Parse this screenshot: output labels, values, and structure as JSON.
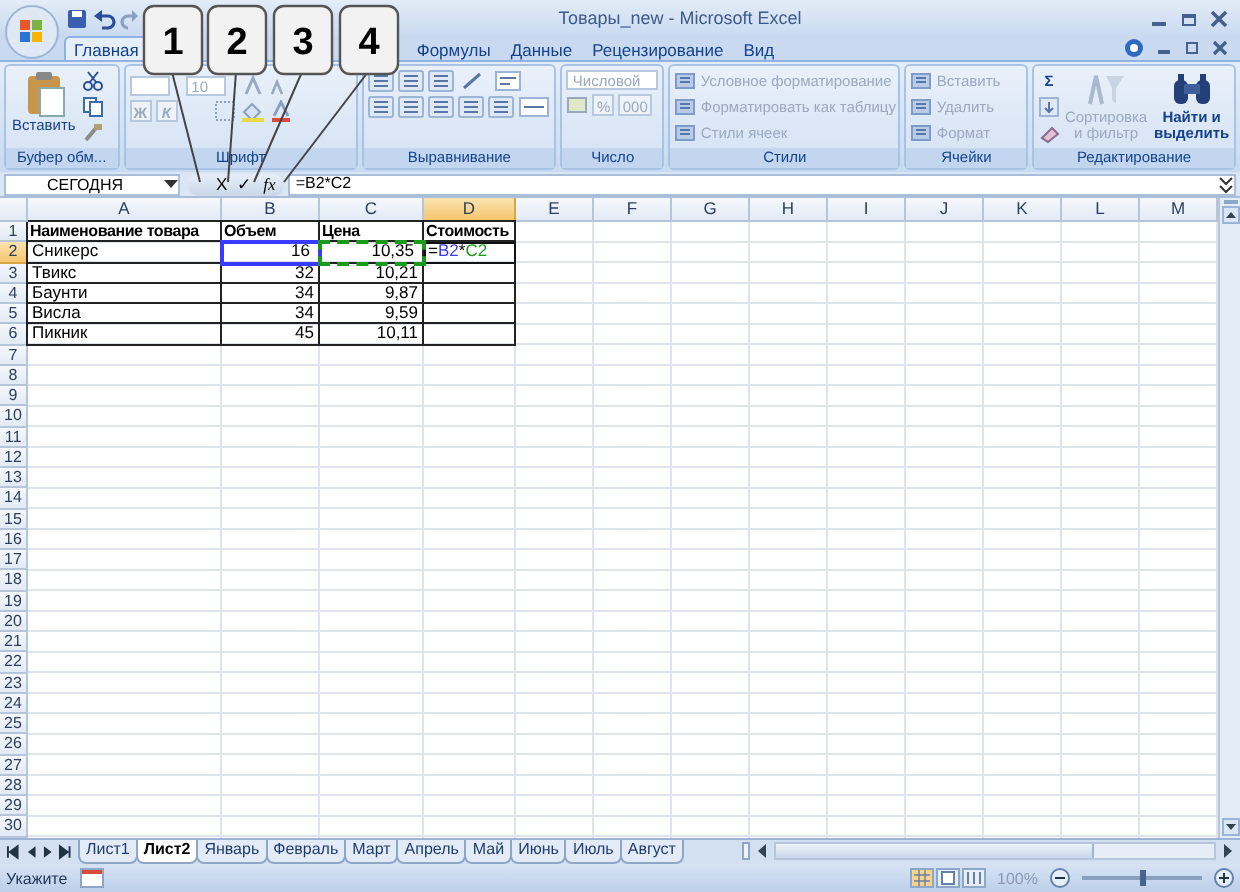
{
  "window": {
    "title": "Товары_new - Microsoft Excel"
  },
  "ribbon_tabs": [
    {
      "label": "Главная",
      "selected": true
    },
    {
      "label": "Формулы",
      "selected": false
    },
    {
      "label": "Данные",
      "selected": false
    },
    {
      "label": "Рецензирование",
      "selected": false
    },
    {
      "label": "Вид",
      "selected": false
    }
  ],
  "ribbon_groups": [
    {
      "kind": "clipboard",
      "label": "Буфер обм...",
      "items": [
        {
          "label": "Вставить",
          "disabled": false
        }
      ]
    },
    {
      "kind": "font",
      "label": "Шрифт",
      "items": [
        {
          "label": "10",
          "disabled": true
        },
        {
          "label": "Ж",
          "disabled": true
        },
        {
          "label": "К",
          "disabled": true
        }
      ]
    },
    {
      "kind": "alignment",
      "label": "Выравнивание"
    },
    {
      "kind": "number",
      "label": "Число",
      "items": [
        {
          "label": "Числовой",
          "disabled": true
        },
        {
          "label": "%",
          "disabled": true
        },
        {
          "label": "000",
          "disabled": true
        }
      ]
    },
    {
      "kind": "styles",
      "label": "Стили",
      "items": [
        {
          "label": "Условное форматирование",
          "disabled": true
        },
        {
          "label": "Форматировать как таблицу",
          "disabled": true
        },
        {
          "label": "Стили ячеек",
          "disabled": true
        }
      ]
    },
    {
      "kind": "cells",
      "label": "Ячейки",
      "items": [
        {
          "label": "Вставить",
          "disabled": true
        },
        {
          "label": "Удалить",
          "disabled": true
        },
        {
          "label": "Формат",
          "disabled": true
        }
      ]
    },
    {
      "kind": "editing",
      "label": "Редактирование",
      "items": [
        {
          "label": "Σ",
          "disabled": false
        },
        {
          "label": "Сортировка и фильтр",
          "disabled": true
        },
        {
          "label": "Найти и выделить",
          "disabled": false
        }
      ]
    }
  ],
  "formula_bar": {
    "name_box": "СЕГОДНЯ",
    "cancel": "X",
    "enter": "✓",
    "function": "fx",
    "formula": "=B2*C2"
  },
  "callouts": [
    {
      "label": "1"
    },
    {
      "label": "2"
    },
    {
      "label": "3"
    },
    {
      "label": "4"
    }
  ],
  "columns": [
    {
      "label": "A",
      "selected": false
    },
    {
      "label": "B",
      "selected": false
    },
    {
      "label": "C",
      "selected": false
    },
    {
      "label": "D",
      "selected": true
    },
    {
      "label": "E",
      "selected": false
    },
    {
      "label": "F",
      "selected": false
    },
    {
      "label": "G",
      "selected": false
    },
    {
      "label": "H",
      "selected": false
    },
    {
      "label": "I",
      "selected": false
    },
    {
      "label": "J",
      "selected": false
    },
    {
      "label": "K",
      "selected": false
    },
    {
      "label": "L",
      "selected": false
    },
    {
      "label": "M",
      "selected": false
    }
  ],
  "rows": [
    {
      "header": "1",
      "selected": false,
      "cells": [
        {
          "kind": "header",
          "text": "Наименование товара"
        },
        {
          "kind": "header",
          "text": "Объем"
        },
        {
          "kind": "header",
          "text": "Цена"
        },
        {
          "kind": "header",
          "text": "Стоимость"
        }
      ]
    },
    {
      "header": "2",
      "selected": true,
      "cells": [
        {
          "kind": "text",
          "text": "Сникерс"
        },
        {
          "kind": "number",
          "text": "16",
          "color": "#3a3aff",
          "marquee": false
        },
        {
          "kind": "number",
          "text": "10,35",
          "color": "#1a9a1a",
          "marquee": true
        },
        {
          "kind": "formula",
          "active": true,
          "parts": [
            {
              "text": "="
            },
            {
              "text": "B2",
              "color": "#3a3aff"
            },
            {
              "text": "*"
            },
            {
              "text": "C2",
              "color": "#1a9a1a"
            }
          ]
        }
      ]
    },
    {
      "header": "3",
      "selected": false,
      "cells": [
        {
          "kind": "text",
          "text": "Твикс"
        },
        {
          "kind": "number",
          "text": "32"
        },
        {
          "kind": "number",
          "text": "10,21"
        },
        {
          "kind": "empty"
        }
      ]
    },
    {
      "header": "4",
      "selected": false,
      "cells": [
        {
          "kind": "text",
          "text": "Баунти"
        },
        {
          "kind": "number",
          "text": "34"
        },
        {
          "kind": "number",
          "text": "9,87"
        },
        {
          "kind": "empty"
        }
      ]
    },
    {
      "header": "5",
      "selected": false,
      "cells": [
        {
          "kind": "text",
          "text": "Висла"
        },
        {
          "kind": "number",
          "text": "34"
        },
        {
          "kind": "number",
          "text": "9,59"
        },
        {
          "kind": "empty"
        }
      ]
    },
    {
      "header": "6",
      "selected": false,
      "cells": [
        {
          "kind": "text",
          "text": "Пикник"
        },
        {
          "kind": "number",
          "text": "45"
        },
        {
          "kind": "number",
          "text": "10,11"
        },
        {
          "kind": "empty"
        }
      ]
    },
    {
      "header": "7",
      "selected": false
    },
    {
      "header": "8",
      "selected": false
    },
    {
      "header": "9",
      "selected": false
    },
    {
      "header": "10",
      "selected": false
    },
    {
      "header": "11",
      "selected": false
    },
    {
      "header": "12",
      "selected": false
    },
    {
      "header": "13",
      "selected": false
    },
    {
      "header": "14",
      "selected": false
    },
    {
      "header": "15",
      "selected": false
    },
    {
      "header": "16",
      "selected": false
    },
    {
      "header": "17",
      "selected": false
    },
    {
      "header": "18",
      "selected": false
    },
    {
      "header": "19",
      "selected": false
    },
    {
      "header": "20",
      "selected": false
    },
    {
      "header": "21",
      "selected": false
    },
    {
      "header": "22",
      "selected": false
    },
    {
      "header": "23",
      "selected": false
    },
    {
      "header": "24",
      "selected": false
    },
    {
      "header": "25",
      "selected": false
    },
    {
      "header": "26",
      "selected": false
    },
    {
      "header": "27",
      "selected": false
    },
    {
      "header": "28",
      "selected": false
    },
    {
      "header": "29",
      "selected": false
    },
    {
      "header": "30",
      "selected": false
    }
  ],
  "sheet_tabs": [
    {
      "label": "Лист1",
      "selected": false
    },
    {
      "label": "Лист2",
      "selected": true
    },
    {
      "label": "Январь",
      "selected": false
    },
    {
      "label": "Февраль",
      "selected": false
    },
    {
      "label": "Март",
      "selected": false
    },
    {
      "label": "Апрель",
      "selected": false
    },
    {
      "label": "Май",
      "selected": false
    },
    {
      "label": "Июнь",
      "selected": false
    },
    {
      "label": "Июль",
      "selected": false
    },
    {
      "label": "Август",
      "selected": false
    }
  ],
  "status_bar": {
    "mode": "Укажите",
    "zoom": "100%",
    "zoom_slider": {
      "level": 0.5
    }
  }
}
